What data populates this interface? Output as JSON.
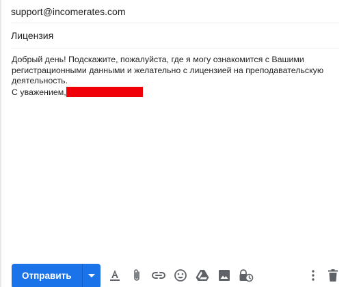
{
  "compose": {
    "to": "support@incomerates.com",
    "subject": "Лицензия",
    "body_lines": [
      "Добрый день! Подскажите, пожалуйста, где я могу ознакомится с Вашими",
      "регистрационными данными и желательно с лицензией на преподавательскую",
      "деятельность."
    ],
    "signature_prefix": "С уважением,"
  },
  "toolbar": {
    "send_label": "Отправить",
    "icons": [
      "send-options-icon",
      "text-format-icon",
      "attach-icon",
      "link-icon",
      "emoji-icon",
      "drive-icon",
      "photo-icon",
      "confidential-mode-icon",
      "more-options-icon",
      "delete-icon"
    ]
  },
  "colors": {
    "accent": "#1a73e8",
    "redaction": "#f00008",
    "icon": "#5f6368"
  }
}
